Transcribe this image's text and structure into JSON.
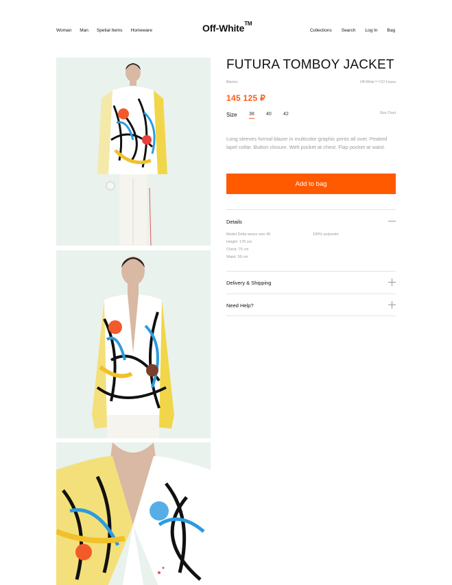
{
  "header": {
    "nav_left": [
      "Woman",
      "Man",
      "Spetial Items",
      "Homeware"
    ],
    "logo": "Off-White",
    "logo_tm": "TM",
    "nav_right": [
      "Collections",
      "Search",
      "Log In",
      "Bag"
    ]
  },
  "product": {
    "title": "FUTURA TOMBOY JACKET",
    "category": "Blazers",
    "brand": "Off-White™ C/O Futura",
    "price": "145 125 ₽",
    "size_label": "Size",
    "sizes": [
      "38",
      "40",
      "42"
    ],
    "selected_size": "38",
    "size_chart": "Size Chart",
    "description": "Long sleeves formal blazer in multicolor graphic prints all over. Peaked lapel collar. Button closure. Welt pocket at chest. Flap pocket at waist.",
    "add_to_bag": "Add to bag"
  },
  "accordion": {
    "details": {
      "title": "Details",
      "lines": [
        "Model Delia wears size 40",
        "Height: 176 cm",
        "Chest: 75 cm",
        "Waist: 59 cm"
      ],
      "material": "100% polyester"
    },
    "delivery": {
      "title": "Delivery & Shipping"
    },
    "help": {
      "title": "Need Help?"
    }
  },
  "colors": {
    "accent": "#ff5a00",
    "photo_bg": "#e9f2ec"
  }
}
